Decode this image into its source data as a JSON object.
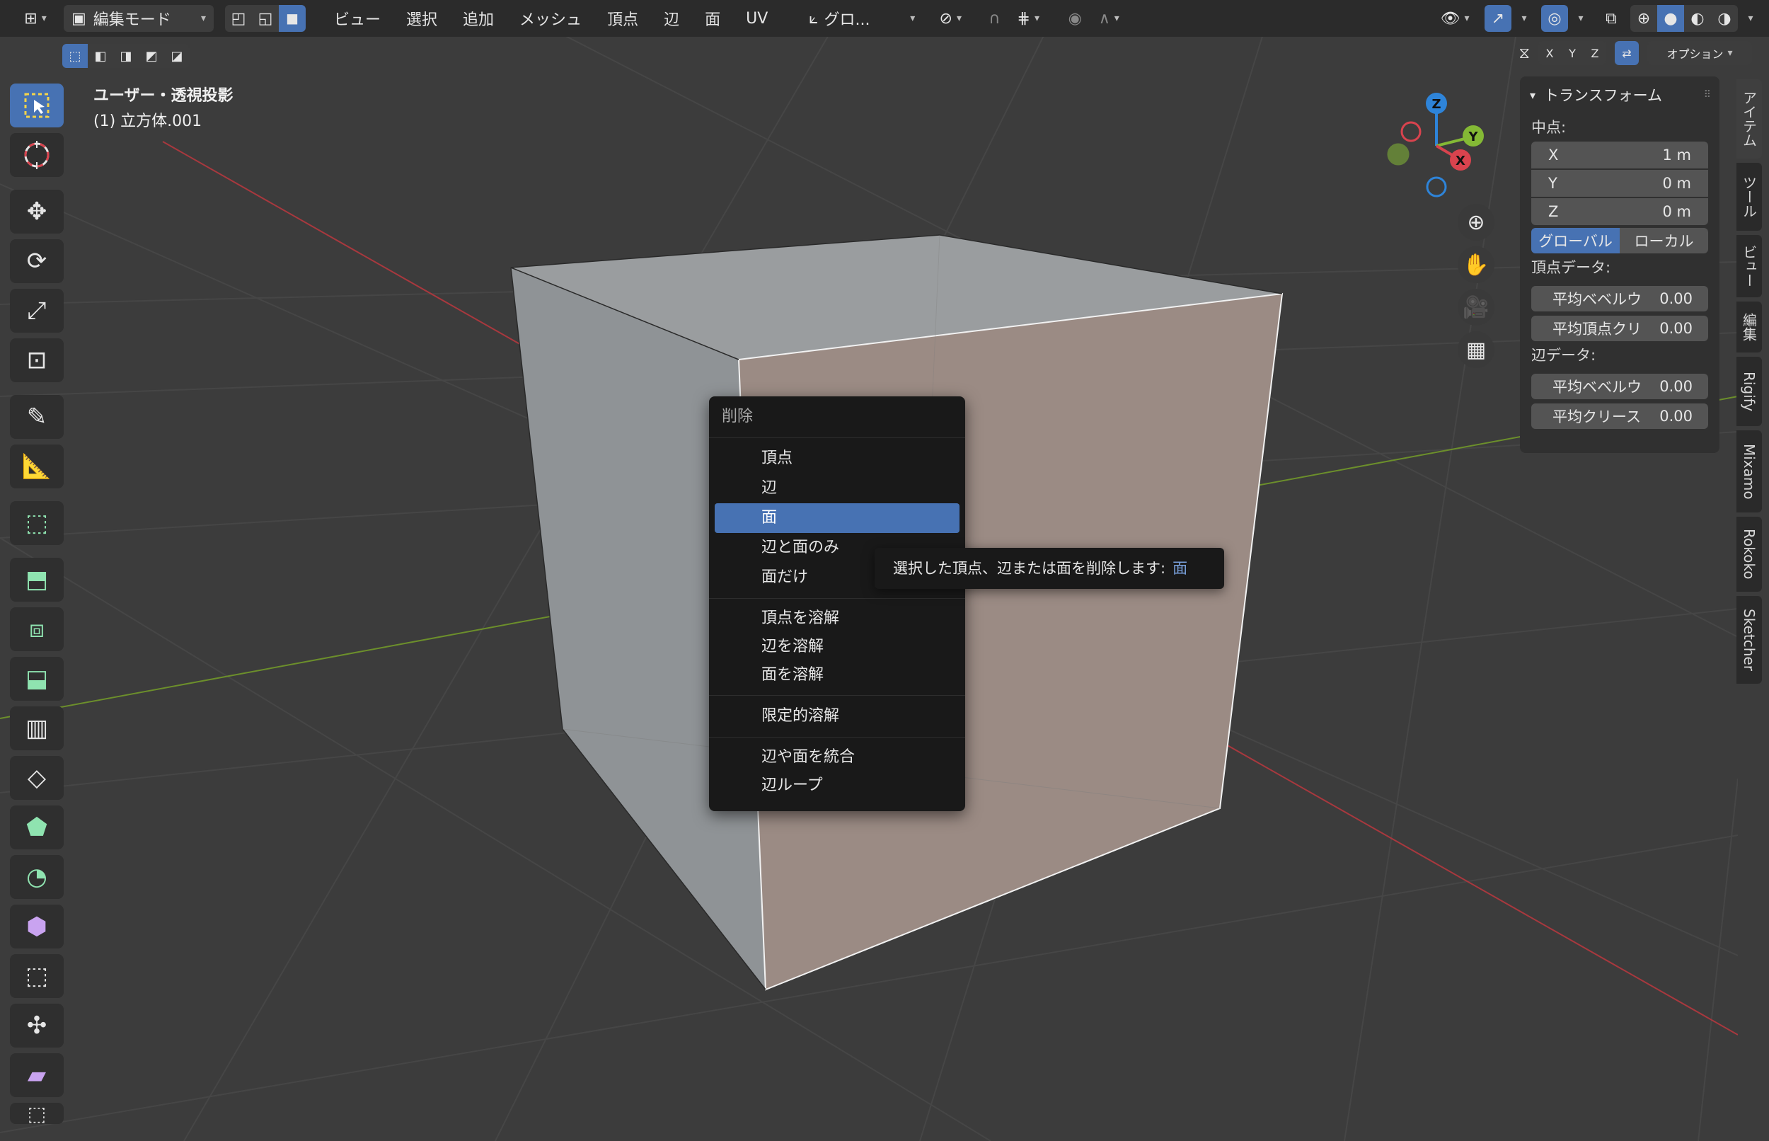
{
  "header": {
    "mode": "編集モード",
    "menus": [
      "ビュー",
      "選択",
      "追加",
      "メッシュ",
      "頂点",
      "辺",
      "面",
      "UV"
    ],
    "transform_orientation": "グロ...",
    "options_label": "オプション",
    "axes": [
      "X",
      "Y",
      "Z"
    ]
  },
  "viewport": {
    "view_name": "ユーザー・透視投影",
    "object_name": "(1) 立方体.001",
    "gizmo_axes": {
      "z": "Z",
      "y": "Y",
      "x": "X"
    }
  },
  "context_menu": {
    "title": "削除",
    "items": [
      "頂点",
      "辺",
      "面",
      "辺と面のみ",
      "面だけ",
      "頂点を溶解",
      "辺を溶解",
      "面を溶解",
      "限定的溶解",
      "辺や面を統合",
      "辺ループ"
    ],
    "active_item": "面"
  },
  "tooltip": {
    "text": "選択した頂点、辺または面を削除します:",
    "value": "面"
  },
  "npanel": {
    "title": "トランスフォーム",
    "median_label": "中点:",
    "fields": [
      {
        "axis": "X",
        "value": "1 m"
      },
      {
        "axis": "Y",
        "value": "0 m"
      },
      {
        "axis": "Z",
        "value": "0 m"
      }
    ],
    "space_global": "グローバル",
    "space_local": "ローカル",
    "vertex_data_label": "頂点データ:",
    "vertex_bevel": {
      "label": "平均ベベルウ",
      "value": "0.00"
    },
    "vertex_crease": {
      "label": "平均頂点クリ",
      "value": "0.00"
    },
    "edge_data_label": "辺データ:",
    "edge_bevel": {
      "label": "平均ベベルウ",
      "value": "0.00"
    },
    "edge_crease": {
      "label": "平均クリース",
      "value": "0.00"
    }
  },
  "tabs": [
    "アイテム",
    "ツール",
    "ビュー",
    "編集",
    "Rigify",
    "Mixamo",
    "Rokoko",
    "Sketcher"
  ],
  "colors": {
    "accent": "#4772b3",
    "x_axis": "#d9434e",
    "y_axis": "#84b935",
    "z_axis": "#2e84d9"
  }
}
